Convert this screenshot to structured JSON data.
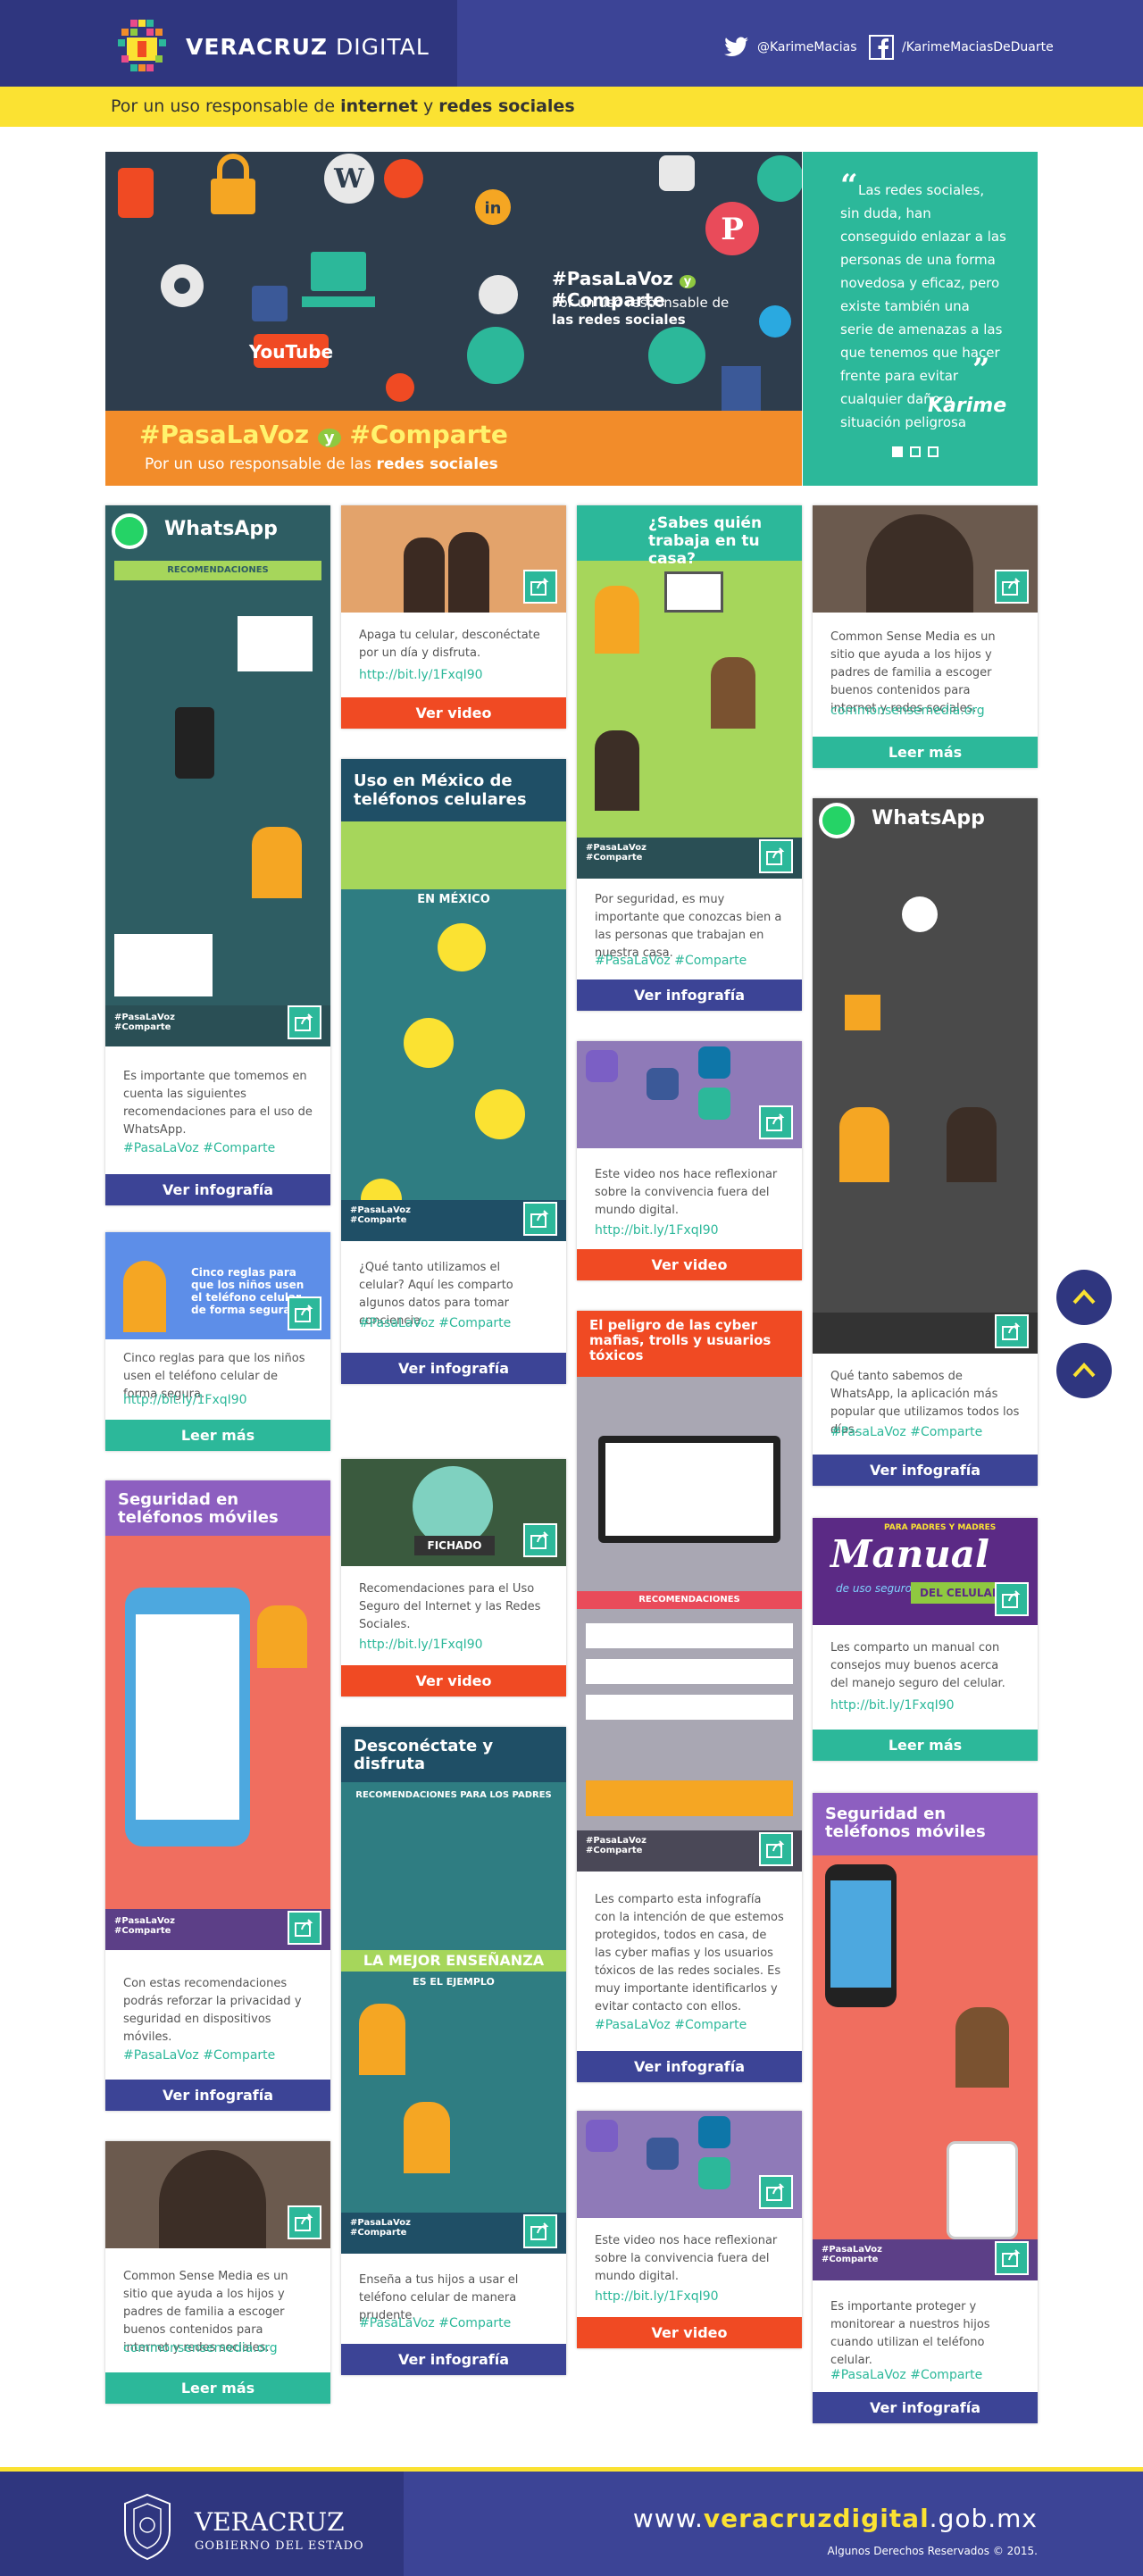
{
  "header": {
    "brand_strong": "VERACRUZ",
    "brand_light": "DIGITAL",
    "twitter": "@KarimeMacias",
    "facebook": "/KarimeMaciasDeDuarte",
    "tagline_pre": "Por un uso responsable de ",
    "tagline_b1": "internet",
    "tagline_mid": " y ",
    "tagline_b2": "redes sociales"
  },
  "hero": {
    "hash1": "#PasaLaVoz",
    "hash_and": "y",
    "hash2": "#Comparte",
    "hash_sub1": "Por un uso responsable de",
    "hash_sub2": "las redes sociales",
    "banner_hash": "#PasaLaVoz",
    "banner_and": "y",
    "banner_hash2": "#Comparte",
    "banner_sub_pre": "Por un uso responsable de las ",
    "banner_sub_b": "redes sociales",
    "youtube": "YouTube",
    "quote": "Las redes sociales, sin duda, han conseguido enlazar a las personas de una forma novedosa y eficaz, pero existe también una serie de amenazas a las que tenemos que hacer frente para evitar cualquier daño o situación peligrosa",
    "quote_author": "Karime"
  },
  "cards": {
    "c1": {
      "title": "WhatsApp",
      "sub": "RECOMENDACIONES",
      "desc": "Es importante que tomemos en cuenta las siguientes recomendaciones para el uso de WhatsApp.",
      "tags": "#PasaLaVoz #Comparte",
      "btn": "Ver infografía"
    },
    "c2": {
      "desc": "Cinco reglas para que los niños usen el teléfono celular de forma segura.",
      "link": "http://bit.ly/1FxqI90",
      "btn": "Leer más",
      "img_title": "Cinco reglas para que los niños usen el teléfono celular de forma segura"
    },
    "c3": {
      "title": "Seguridad en teléfonos móviles",
      "desc": "Con estas recomendaciones podrás reforzar la privacidad y seguridad en dispositivos móviles.",
      "tags": "#PasaLaVoz #Comparte",
      "btn": "Ver infografía"
    },
    "c4": {
      "desc": "Common Sense Media es un sitio que ayuda a los hijos y padres de familia a escoger buenos contenidos para internet y redes sociales.",
      "link": "commonsensemedia.org",
      "btn": "Leer más"
    },
    "c5": {
      "desc": "Apaga tu celular, desconéctate por un día y disfruta.",
      "link": "http://bit.ly/1FxqI90",
      "btn": "Ver video"
    },
    "c6": {
      "title": "Uso en México de teléfonos celulares",
      "sub": "EN MÉXICO",
      "desc": "¿Qué tanto utilizamos el celular? Aquí les comparto algunos datos para tomar conciencia.",
      "tags": "#PasaLaVoz #Comparte",
      "btn": "Ver infografía"
    },
    "c7": {
      "img_label": "FICHADO",
      "desc": "Recomendaciones para el Uso Seguro del Internet y las Redes Sociales.",
      "link": "http://bit.ly/1FxqI90",
      "btn": "Ver video"
    },
    "c8": {
      "title": "Desconéctate y disfruta",
      "sub": "RECOMENDACIONES PARA LOS PADRES",
      "sub2": "LA MEJOR ENSEÑANZA",
      "sub3": "ES EL EJEMPLO",
      "desc": "Enseña a tus hijos a usar el teléfono celular de manera prudente.",
      "tags": "#PasaLaVoz #Comparte",
      "btn": "Ver infografía"
    },
    "c9": {
      "title": "¿Sabes quién trabaja en tu casa?",
      "desc": "Por seguridad, es muy importante que conozcas bien a las personas que trabajan en nuestra casa.",
      "tags": "#PasaLaVoz #Comparte",
      "btn": "Ver infografía"
    },
    "c10": {
      "desc": "Este video nos hace reflexionar sobre la convivencia fuera del mundo digital.",
      "link": "http://bit.ly/1FxqI90",
      "btn": "Ver video"
    },
    "c11": {
      "title": "El peligro de las cyber mafias, trolls y usuarios tóxicos",
      "sub": "RECOMENDACIONES",
      "desc": "Les comparto esta infografía con la intención de que estemos protegidos, todos en casa, de las cyber mafias y los usuarios tóxicos de las redes sociales. Es muy importante identificarlos y evitar contacto con ellos.",
      "tags": "#PasaLaVoz #Comparte",
      "btn": "Ver infografía"
    },
    "c12": {
      "desc": "Este video nos hace reflexionar sobre la convivencia fuera del mundo digital.",
      "link": "http://bit.ly/1FxqI90",
      "btn": "Ver video"
    },
    "c13": {
      "desc": "Common Sense Media es un sitio que ayuda a los hijos y padres de familia a escoger buenos contenidos para internet y redes sociales.",
      "link": "commonsensemedia.org",
      "btn": "Leer más"
    },
    "c14": {
      "title": "WhatsApp",
      "desc": "Qué tanto sabemos de WhatsApp, la aplicación más popular que utilizamos todos los días.",
      "tags": "#PasaLaVoz #Comparte",
      "btn": "Ver infografía"
    },
    "c15": {
      "img_small": "PARA PADRES Y MADRES",
      "img_big": "Manual",
      "img_small2": "de uso seguro",
      "img_band": "DEL CELULAR",
      "desc": "Les comparto un manual con consejos muy buenos acerca del manejo seguro del celular.",
      "link": "http://bit.ly/1FxqI90",
      "btn": "Leer más"
    },
    "c16": {
      "title": "Seguridad en teléfonos móviles",
      "desc": "Es importante proteger y monitorear a nuestros hijos cuando utilizan el teléfono celular.",
      "tags": "#PasaLaVoz #Comparte",
      "btn": "Ver infografía"
    }
  },
  "footer": {
    "vz": "VERACRUZ",
    "ge": "GOBIERNO DEL ESTADO",
    "url_pre": "www.",
    "url_b": "veracruzdigital",
    "url_post": ".gob.mx",
    "rights": "Algunos Derechos Reservados © 2015."
  },
  "colors": {
    "brand": "#3c4496",
    "accent": "#fbe232",
    "teal": "#2cb89a",
    "red": "#f04a23"
  }
}
